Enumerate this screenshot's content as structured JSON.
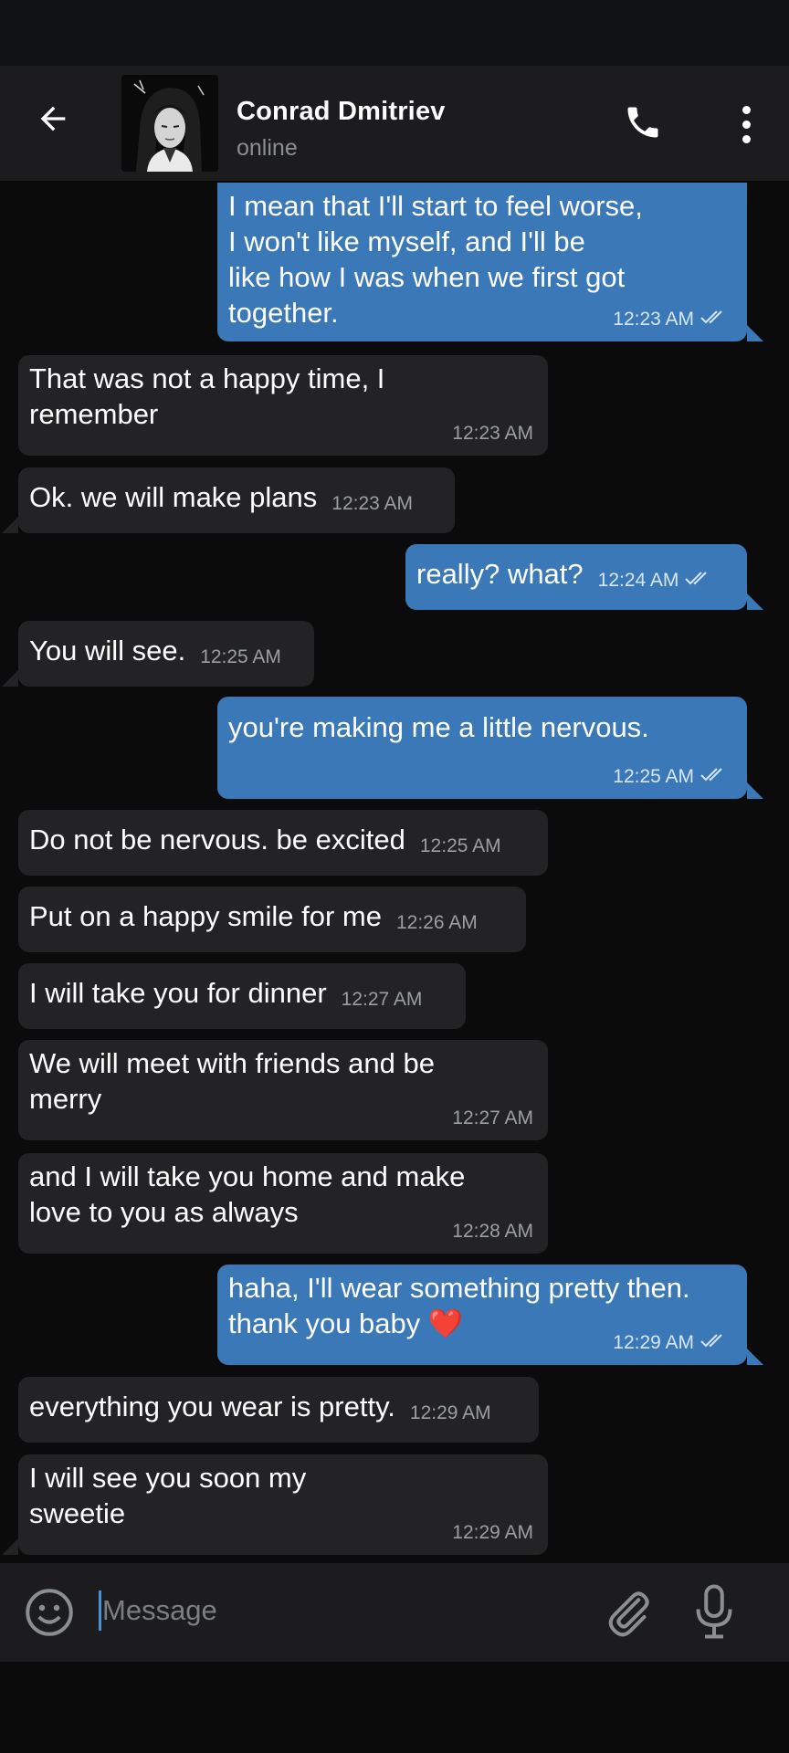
{
  "header": {
    "contact_name": "Conrad Dmitriev",
    "contact_status": "online"
  },
  "messages": [
    {
      "dir": "out",
      "text": "I mean that I'll start to feel worse,\nI won't like myself, and I'll be\nlike how I was when we first got\ntogether.",
      "time": "12:23 AM",
      "read": true
    },
    {
      "dir": "in",
      "text": "That was not a happy time, I\nremember",
      "time": "12:23 AM"
    },
    {
      "dir": "in",
      "text": "Ok. we will make plans",
      "time": "12:23 AM"
    },
    {
      "dir": "out",
      "text": "really? what?",
      "time": "12:24 AM",
      "read": true
    },
    {
      "dir": "in",
      "text": "You will see.",
      "time": "12:25 AM"
    },
    {
      "dir": "out",
      "text": "you're making me a little nervous.",
      "time": "12:25 AM",
      "read": true
    },
    {
      "dir": "in",
      "text": "Do not be nervous. be excited",
      "time": "12:25 AM"
    },
    {
      "dir": "in",
      "text": "Put on a happy smile for me",
      "time": "12:26 AM"
    },
    {
      "dir": "in",
      "text": "I will take you for dinner",
      "time": "12:27 AM"
    },
    {
      "dir": "in",
      "text": "We will meet with friends and be\nmerry",
      "time": "12:27 AM"
    },
    {
      "dir": "in",
      "text": "and I will take you home and make\nlove to you as always",
      "time": "12:28 AM"
    },
    {
      "dir": "out",
      "text": "haha, I'll wear something pretty then.\nthank you baby ❤️",
      "time": "12:29 AM",
      "read": true
    },
    {
      "dir": "in",
      "text": "everything you wear is pretty.",
      "time": "12:29 AM"
    },
    {
      "dir": "in",
      "text": "I will see you soon my\nsweetie",
      "time": "12:29 AM"
    }
  ],
  "input": {
    "placeholder": "Message"
  },
  "icons": {
    "back": "arrow-left-icon",
    "call": "phone-icon",
    "menu": "more-vert-icon",
    "emoji": "emoji-icon",
    "attach": "paperclip-icon",
    "mic": "microphone-icon",
    "read_ticks": "double-check-icon"
  },
  "colors": {
    "outgoing_bubble": "#3b78b8",
    "incoming_bubble": "#232325",
    "header_bg": "#1c1c1e",
    "background": "#0b0b0c"
  }
}
